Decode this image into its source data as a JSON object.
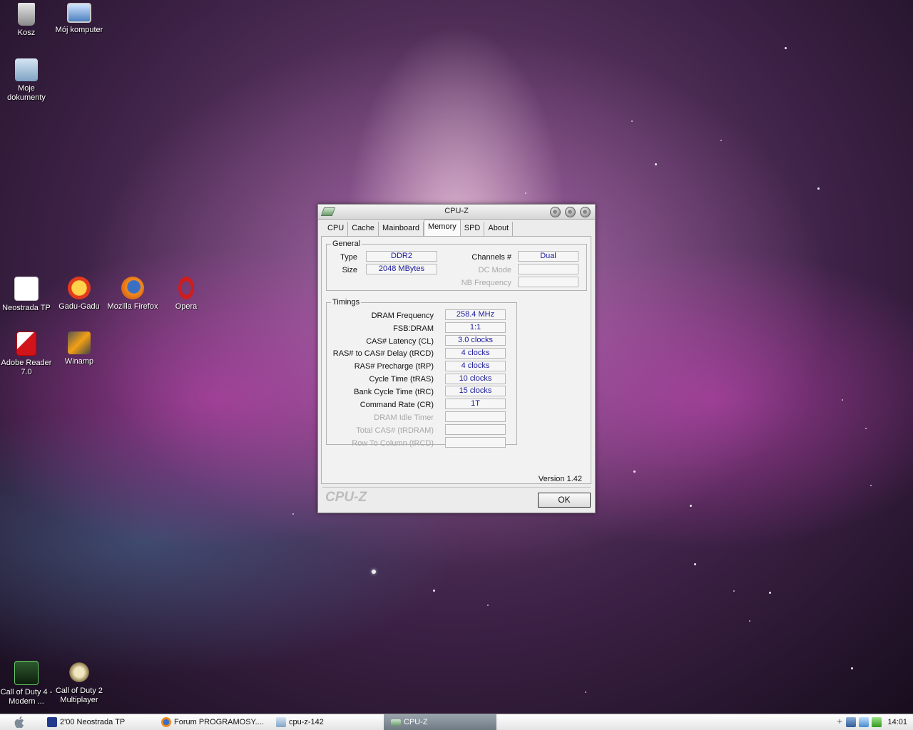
{
  "desktop": {
    "icons": [
      {
        "label": "Kosz"
      },
      {
        "label": "Mój komputer"
      },
      {
        "label": "Moje dokumenty"
      },
      {
        "label": "Neostrada TP"
      },
      {
        "label": "Gadu-Gadu"
      },
      {
        "label": "Mozilla Firefox"
      },
      {
        "label": "Opera"
      },
      {
        "label": "Adobe Reader 7.0"
      },
      {
        "label": "Winamp"
      },
      {
        "label": "Call of Duty 4 - Modern ..."
      },
      {
        "label": "Call of Duty 2 Multiplayer"
      }
    ]
  },
  "window": {
    "title": "CPU-Z",
    "tabs": [
      "CPU",
      "Cache",
      "Mainboard",
      "Memory",
      "SPD",
      "About"
    ],
    "active_tab": "Memory",
    "general": {
      "legend": "General",
      "type_label": "Type",
      "type_value": "DDR2",
      "size_label": "Size",
      "size_value": "2048 MBytes",
      "channels_label": "Channels #",
      "channels_value": "Dual",
      "dc_mode_label": "DC Mode",
      "dc_mode_value": "",
      "nb_freq_label": "NB Frequency",
      "nb_freq_value": ""
    },
    "timings": {
      "legend": "Timings",
      "rows": [
        {
          "label": "DRAM Frequency",
          "value": "258.4 MHz",
          "enabled": true
        },
        {
          "label": "FSB:DRAM",
          "value": "1:1",
          "enabled": true
        },
        {
          "label": "CAS# Latency (CL)",
          "value": "3.0 clocks",
          "enabled": true
        },
        {
          "label": "RAS# to CAS# Delay (tRCD)",
          "value": "4 clocks",
          "enabled": true
        },
        {
          "label": "RAS# Precharge (tRP)",
          "value": "4 clocks",
          "enabled": true
        },
        {
          "label": "Cycle Time (tRAS)",
          "value": "10 clocks",
          "enabled": true
        },
        {
          "label": "Bank Cycle Time (tRC)",
          "value": "15 clocks",
          "enabled": true
        },
        {
          "label": "Command Rate (CR)",
          "value": "1T",
          "enabled": true
        },
        {
          "label": "DRAM Idle Timer",
          "value": "",
          "enabled": false
        },
        {
          "label": "Total CAS# (tRDRAM)",
          "value": "",
          "enabled": false
        },
        {
          "label": "Row To Column (tRCD)",
          "value": "",
          "enabled": false
        }
      ]
    },
    "version": "Version 1.42",
    "logo": "CPU-Z",
    "ok_label": "OK"
  },
  "taskbar": {
    "items": [
      {
        "label": "2'00 Neostrada TP"
      },
      {
        "label": "Forum PROGRAMOSY...."
      },
      {
        "label": "cpu-z-142"
      },
      {
        "label": "CPU-Z"
      }
    ],
    "clock": "14:01"
  },
  "colors": {
    "value_text": "#1a1a9a",
    "taskbar_active": "#6f7a84"
  }
}
